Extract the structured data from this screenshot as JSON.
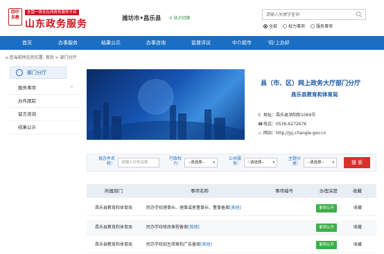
{
  "header": {
    "seal_text": "四中东教",
    "portal_sub": "全国一体化在线政务服务平台",
    "portal_title": "山东政务服务",
    "city": "潍坊市•昌乐县",
    "switch_label": "站点切换",
    "search_placeholder": "请输入关键字查询",
    "radios": [
      {
        "label": "全部",
        "selected": true
      },
      {
        "label": "权力事项",
        "selected": false
      },
      {
        "label": "服务事项",
        "selected": false
      }
    ]
  },
  "nav": [
    "首页",
    "办事服务",
    "结果公示",
    "办事咨询",
    "监督评议",
    "中介超市",
    "'码'上办好"
  ],
  "breadcrumb": {
    "prefix": "您当前所在的位置:",
    "items": [
      "首页",
      "部门分厅"
    ]
  },
  "sidebar": {
    "title": "部门分厅",
    "items": [
      "服务事项",
      "办件跟踪",
      "留言咨询",
      "结果公示"
    ]
  },
  "department": {
    "title": "县（市、区）网上政务大厅部门分厅",
    "name": "昌乐县教育和体育局",
    "address": "地址：昌乐县洪阳街1069号",
    "phone": "电话：0536-6272676",
    "website": "网站：http://jyj.changle.gov.cn"
  },
  "filter": {
    "item_name_label": "按办件名称：",
    "item_name_placeholder": "请输入办件名称",
    "power_label": "行政权力：",
    "service_label": "公共服务：",
    "theme_label": "主题分类：",
    "select_placeholder": "--请选择--",
    "search_button": "搜 索"
  },
  "table": {
    "headers": [
      "所属部门",
      "事项名称",
      "事项编号",
      "办理深度",
      "收藏"
    ],
    "rows": [
      {
        "dept": "昌乐县教育和体育局",
        "name": "民办学校理事长、理事或者董事长、董事备案",
        "tag": "[其他]",
        "code": "",
        "depth": "事项公开",
        "fav": "收藏"
      },
      {
        "dept": "昌乐县教育和体育局",
        "name": "民办学校修改章程备案",
        "tag": "[其他]",
        "code": "",
        "depth": "事项公开",
        "fav": "收藏"
      },
      {
        "dept": "昌乐县教育和体育局",
        "name": "民办学校招生简章和广告备案",
        "tag": "[其他]",
        "code": "",
        "depth": "事项公开",
        "fav": "收藏"
      }
    ]
  },
  "colors": {
    "brand_red": "#c8161d",
    "nav_blue": "#1a6fc4",
    "badge_green": "#3dae4a",
    "search_red": "#d9302a"
  }
}
